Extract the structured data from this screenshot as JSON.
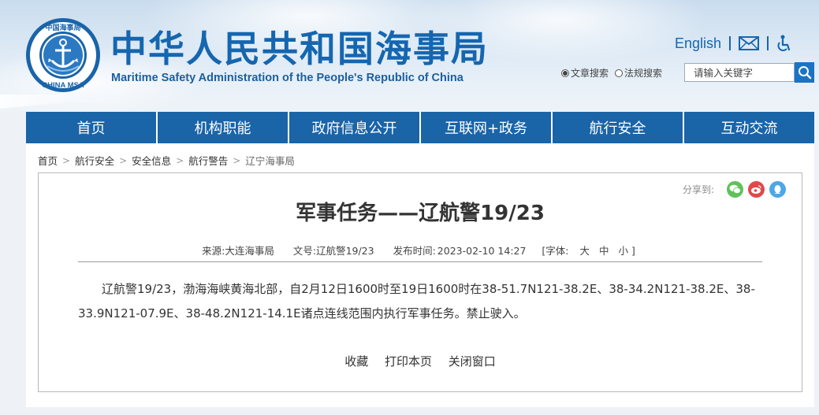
{
  "site": {
    "title": "中华人民共和国海事局",
    "subtitle": "Maritime Safety Administration of the People's Republic of China",
    "logo_top_text": "中国海事局",
    "logo_bottom_text": "CHINA MSA"
  },
  "top_links": {
    "english": "English",
    "mail_icon": "mail-icon",
    "accessibility_icon": "accessibility-icon"
  },
  "search": {
    "option_article": "文章搜索",
    "option_law": "法规搜索",
    "placeholder": "请输入关键字"
  },
  "nav": [
    "首页",
    "机构职能",
    "政府信息公开",
    "互联网+政务",
    "航行安全",
    "互动交流"
  ],
  "breadcrumb": [
    "首页",
    "航行安全",
    "安全信息",
    "航行警告",
    "辽宁海事局"
  ],
  "share": {
    "label": "分享到:",
    "icons": [
      "wechat-icon",
      "weibo-icon",
      "qq-icon"
    ]
  },
  "article": {
    "title": "军事任务——辽航警19/23",
    "source_label": "来源:",
    "source": "大连海事局",
    "docno_label": "文号:",
    "docno": "辽航警19/23",
    "time_label": "发布时间:",
    "time": "2023-02-10 14:27",
    "font_label": "[字体:",
    "font_large": "大",
    "font_medium": "中",
    "font_small": "小 ]",
    "body": "辽航警19/23，渤海海峡黄海北部，自2月12日1600时至19日1600时在38-51.7N121-38.2E、38-34.2N121-38.2E、38-33.9N121-07.9E、38-48.2N121-14.1E诸点连线范围内执行军事任务。禁止驶入。"
  },
  "actions": {
    "favorite": "收藏",
    "print": "打印本页",
    "close": "关闭窗口"
  },
  "colors": {
    "brand_blue": "#1566b0",
    "nav_blue": "#1a64a8",
    "wechat": "#5fc15a",
    "weibo": "#e0484a",
    "qq": "#4aa7e8"
  }
}
